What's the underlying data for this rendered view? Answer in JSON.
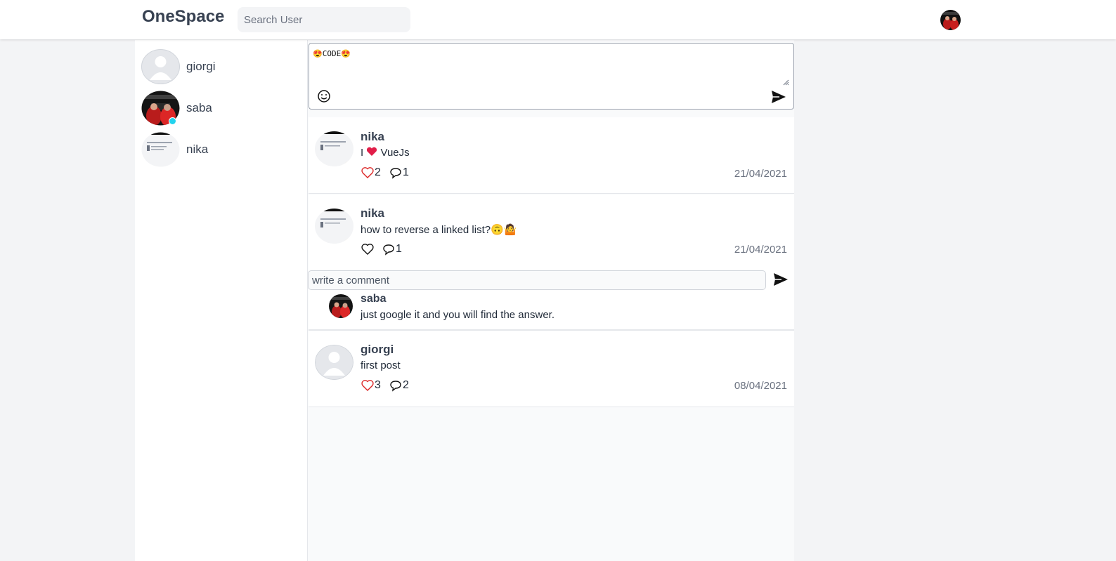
{
  "header": {
    "brand": "OneSpace",
    "search_placeholder": "Search User"
  },
  "sidebar": {
    "users": [
      {
        "name": "giorgi",
        "online": false
      },
      {
        "name": "saba",
        "online": true
      },
      {
        "name": "nika",
        "online": false
      }
    ]
  },
  "composer": {
    "text": "😍CODE😍"
  },
  "posts": [
    {
      "author": "nika",
      "body_prefix": "I ",
      "body_suffix": " VueJs",
      "likes": "2",
      "comments": "1",
      "date": "21/04/2021",
      "liked": true
    },
    {
      "author": "nika",
      "body": "how to reverse a linked list?🙃🤷",
      "likes": "",
      "comments": "1",
      "date": "21/04/2021",
      "liked": false
    },
    {
      "author": "giorgi",
      "body": "first post",
      "likes": "3",
      "comments": "2",
      "date": "08/04/2021",
      "liked": true
    }
  ],
  "comment_box": {
    "placeholder": "write a comment"
  },
  "comments": [
    {
      "author": "saba",
      "text": "just google it and you will find the answer."
    }
  ],
  "colors": {
    "liked": "#dc2626",
    "online": "#22d3ee",
    "heart_emoji": "#e11d48"
  }
}
